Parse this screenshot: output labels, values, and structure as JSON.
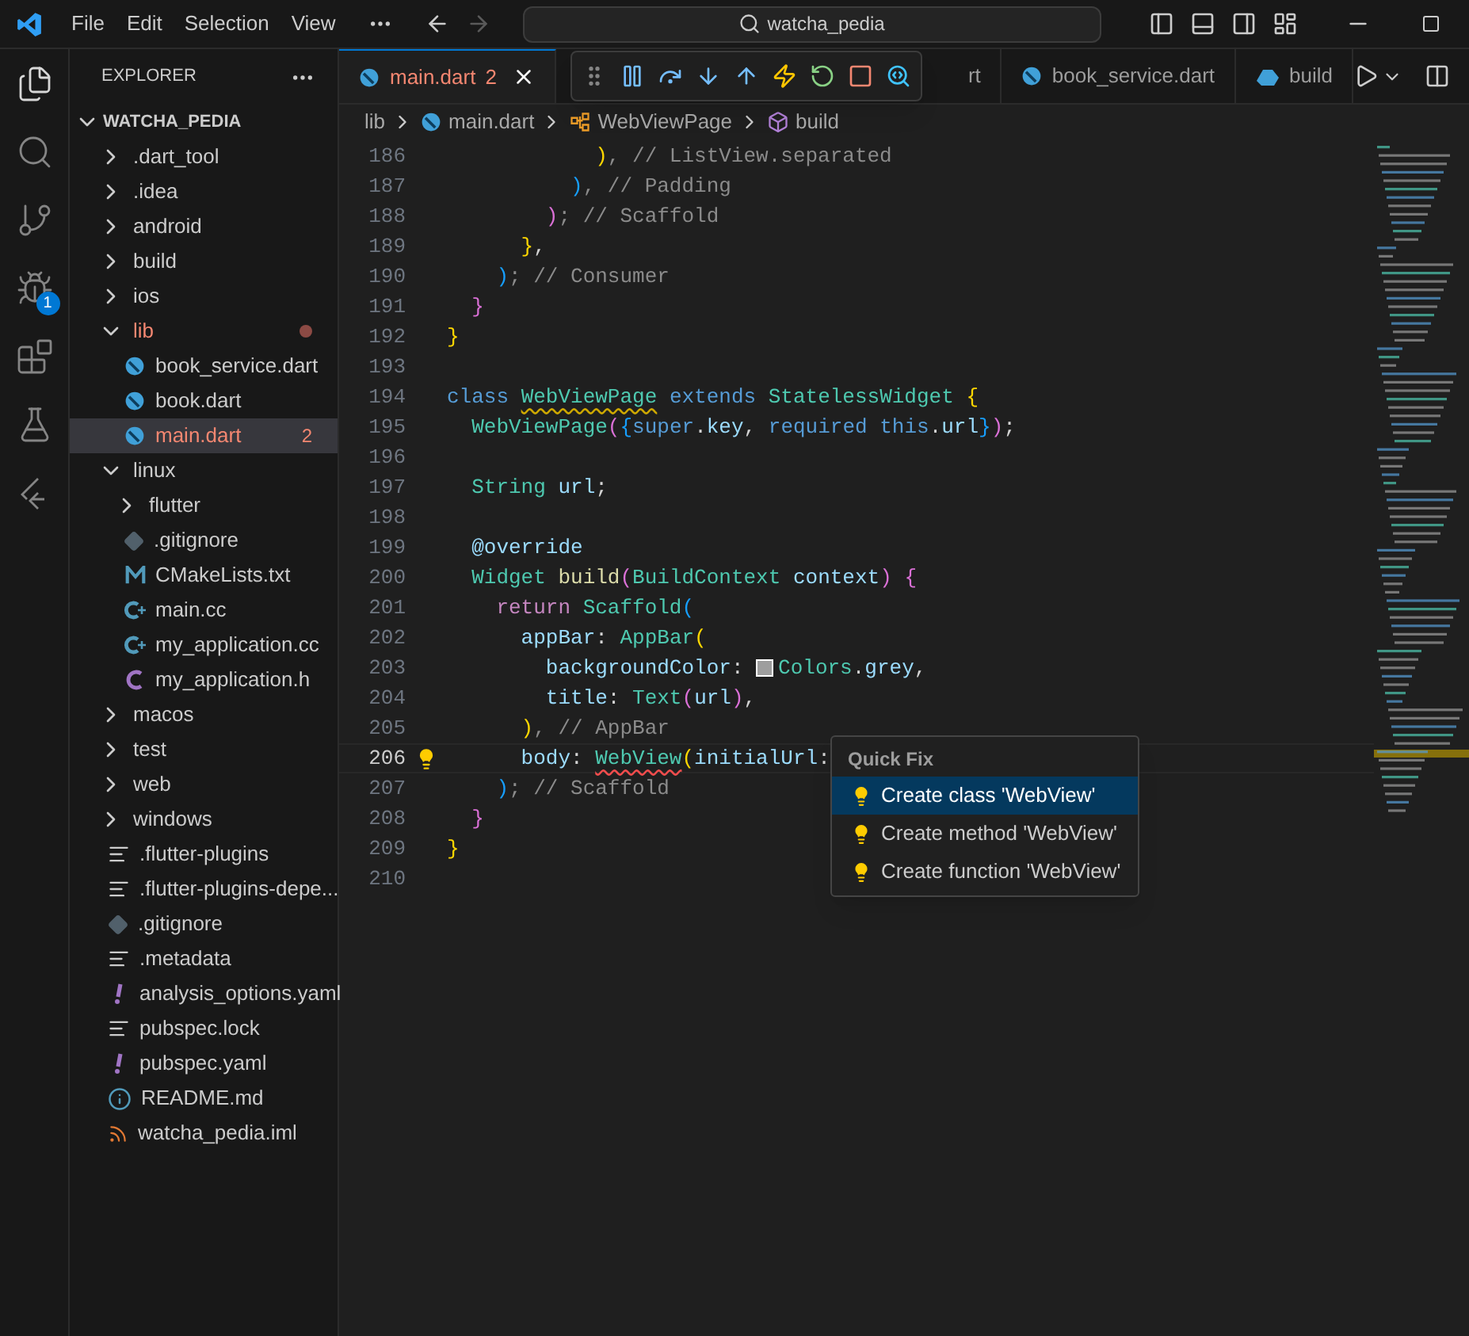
{
  "title_bar": {
    "menus": [
      "File",
      "Edit",
      "Selection",
      "View"
    ],
    "search": "watcha_pedia"
  },
  "activity_bar": [
    {
      "kind": "files",
      "selected": true
    },
    {
      "kind": "search",
      "selected": false
    },
    {
      "kind": "git",
      "selected": false
    },
    {
      "kind": "debug",
      "selected": false,
      "badge": "1"
    },
    {
      "kind": "extensions",
      "selected": false
    },
    {
      "kind": "testing",
      "selected": false
    },
    {
      "kind": "flutter",
      "selected": false
    }
  ],
  "explorer": {
    "title": "EXPLORER",
    "project": "WATCHA_PEDIA",
    "items": [
      {
        "kind": "folder",
        "name": ".dart_tool",
        "expanded": false
      },
      {
        "kind": "folder",
        "name": ".idea",
        "expanded": false
      },
      {
        "kind": "folder",
        "name": "android",
        "expanded": false
      },
      {
        "kind": "folder",
        "name": "build",
        "expanded": false
      },
      {
        "kind": "folder",
        "name": "ios",
        "expanded": false
      },
      {
        "kind": "folder",
        "name": "lib",
        "expanded": true,
        "error": true,
        "dot": true,
        "children": [
          {
            "kind": "dart",
            "name": "book_service.dart",
            "selected": false
          },
          {
            "kind": "dart",
            "name": "book.dart",
            "selected": false
          },
          {
            "kind": "dart",
            "name": "main.dart",
            "selected": true,
            "error": true,
            "badge": "2"
          }
        ]
      },
      {
        "kind": "folder",
        "name": "linux",
        "expanded": true,
        "children": [
          {
            "kind": "folder",
            "name": "flutter",
            "expanded": false
          },
          {
            "kind": "git",
            "name": ".gitignore"
          },
          {
            "kind": "cmake",
            "name": "CMakeLists.txt"
          },
          {
            "kind": "cpp",
            "name": "main.cc"
          },
          {
            "kind": "cpp",
            "name": "my_application.cc"
          },
          {
            "kind": "c",
            "name": "my_application.h"
          }
        ]
      },
      {
        "kind": "folder",
        "name": "macos",
        "expanded": false
      },
      {
        "kind": "folder",
        "name": "test",
        "expanded": false
      },
      {
        "kind": "folder",
        "name": "web",
        "expanded": false
      },
      {
        "kind": "folder",
        "name": "windows",
        "expanded": false
      },
      {
        "kind": "lines",
        "name": ".flutter-plugins"
      },
      {
        "kind": "lines",
        "name": ".flutter-plugins-depe..."
      },
      {
        "kind": "git",
        "name": ".gitignore"
      },
      {
        "kind": "lines",
        "name": ".metadata"
      },
      {
        "kind": "yaml",
        "name": "analysis_options.yaml"
      },
      {
        "kind": "lines",
        "name": "pubspec.lock"
      },
      {
        "kind": "yaml",
        "name": "pubspec.yaml"
      },
      {
        "kind": "info",
        "name": "README.md"
      },
      {
        "kind": "rss",
        "name": "watcha_pedia.iml"
      }
    ]
  },
  "tabs": [
    {
      "kind": "dart",
      "label": "main.dart",
      "badge": "2",
      "selected": true,
      "error": true
    },
    {
      "label": "rt",
      "selected": false
    },
    {
      "kind": "dart",
      "label": "book_service.dart",
      "selected": false
    },
    {
      "kind": "devtools",
      "label": "build",
      "selected": false
    }
  ],
  "breadcrumbs": [
    {
      "kind": "folder",
      "label": "lib"
    },
    {
      "kind": "dart",
      "label": "main.dart"
    },
    {
      "kind": "class",
      "label": "WebViewPage"
    },
    {
      "kind": "method",
      "label": "build"
    }
  ],
  "debug_toolbar": [
    {
      "kind": "grip"
    },
    {
      "kind": "pause"
    },
    {
      "kind": "step-over"
    },
    {
      "kind": "step-into"
    },
    {
      "kind": "step-out"
    },
    {
      "kind": "hot-reload"
    },
    {
      "kind": "restart"
    },
    {
      "kind": "stop"
    },
    {
      "kind": "devtools"
    }
  ],
  "code": [
    {
      "number": "186",
      "tokens": [
        {
          "text": "            )",
          "kind": "b1"
        },
        {
          "text": ", // ListView.separated",
          "kind": "cmt"
        }
      ]
    },
    {
      "number": "187",
      "tokens": [
        {
          "text": "          )",
          "kind": "b3"
        },
        {
          "text": ", // Padding",
          "kind": "cmt"
        }
      ]
    },
    {
      "number": "188",
      "tokens": [
        {
          "text": "        )",
          "kind": "b2"
        },
        {
          "text": "; // Scaffold",
          "kind": "cmt"
        }
      ]
    },
    {
      "number": "189",
      "tokens": [
        {
          "text": "      }",
          "kind": "b1"
        },
        {
          "text": ",",
          "kind": "p"
        }
      ]
    },
    {
      "number": "190",
      "tokens": [
        {
          "text": "    )",
          "kind": "b3"
        },
        {
          "text": "; // Consumer",
          "kind": "cmt"
        }
      ]
    },
    {
      "number": "191",
      "tokens": [
        {
          "text": "  }",
          "kind": "b2"
        }
      ]
    },
    {
      "number": "192",
      "tokens": [
        {
          "text": "}",
          "kind": "b1"
        }
      ]
    },
    {
      "number": "193"
    },
    {
      "number": "194",
      "tokens": [
        {
          "text": "class ",
          "kind": "kw"
        },
        {
          "text": "WebViewPage",
          "kind": "type",
          "warning": true
        },
        {
          "text": " extends ",
          "kind": "kw"
        },
        {
          "text": "StatelessWidget ",
          "kind": "type"
        },
        {
          "text": "{",
          "kind": "b1"
        }
      ]
    },
    {
      "number": "195",
      "tokens": [
        {
          "text": "  WebViewPage",
          "kind": "type"
        },
        {
          "text": "(",
          "kind": "b2"
        },
        {
          "text": "{",
          "kind": "b3"
        },
        {
          "text": "super",
          "kind": "kw"
        },
        {
          "text": ".",
          "kind": "p"
        },
        {
          "text": "key",
          "kind": "var"
        },
        {
          "text": ", ",
          "kind": "p"
        },
        {
          "text": "required this",
          "kind": "kw"
        },
        {
          "text": ".",
          "kind": "p"
        },
        {
          "text": "url",
          "kind": "var"
        },
        {
          "text": "}",
          "kind": "b3"
        },
        {
          "text": ")",
          "kind": "b2"
        },
        {
          "text": ";",
          "kind": "p"
        }
      ]
    },
    {
      "number": "196"
    },
    {
      "number": "197",
      "tokens": [
        {
          "text": "  String ",
          "kind": "type"
        },
        {
          "text": "url",
          "kind": "var"
        },
        {
          "text": ";",
          "kind": "p"
        }
      ]
    },
    {
      "number": "198"
    },
    {
      "number": "199",
      "tokens": [
        {
          "text": "  @override",
          "kind": "var"
        }
      ]
    },
    {
      "number": "200",
      "tokens": [
        {
          "text": "  Widget ",
          "kind": "type"
        },
        {
          "text": "build",
          "kind": "fn"
        },
        {
          "text": "(",
          "kind": "b2"
        },
        {
          "text": "BuildContext ",
          "kind": "type"
        },
        {
          "text": "context",
          "kind": "var"
        },
        {
          "text": ") ",
          "kind": "b2"
        },
        {
          "text": "{",
          "kind": "b2"
        }
      ]
    },
    {
      "number": "201",
      "tokens": [
        {
          "text": "    return ",
          "kind": "ctl"
        },
        {
          "text": "Scaffold",
          "kind": "type"
        },
        {
          "text": "(",
          "kind": "b3"
        }
      ]
    },
    {
      "number": "202",
      "tokens": [
        {
          "text": "      appBar",
          "kind": "var"
        },
        {
          "text": ": ",
          "kind": "p"
        },
        {
          "text": "AppBar",
          "kind": "type"
        },
        {
          "text": "(",
          "kind": "b1"
        }
      ]
    },
    {
      "number": "203",
      "tokens": [
        {
          "text": "        backgroundColor",
          "kind": "var"
        },
        {
          "text": ": ",
          "kind": "p"
        },
        {
          "kind": "swatch"
        },
        {
          "text": "Colors",
          "kind": "type"
        },
        {
          "text": ".",
          "kind": "p"
        },
        {
          "text": "grey",
          "kind": "var"
        },
        {
          "text": ",",
          "kind": "p"
        }
      ]
    },
    {
      "number": "204",
      "tokens": [
        {
          "text": "        title",
          "kind": "var"
        },
        {
          "text": ": ",
          "kind": "p"
        },
        {
          "text": "Text",
          "kind": "type"
        },
        {
          "text": "(",
          "kind": "b2"
        },
        {
          "text": "url",
          "kind": "var"
        },
        {
          "text": ")",
          "kind": "b2"
        },
        {
          "text": ",",
          "kind": "p"
        }
      ]
    },
    {
      "number": "205",
      "tokens": [
        {
          "text": "      )",
          "kind": "b1"
        },
        {
          "text": ", // AppBar",
          "kind": "cmt"
        }
      ]
    },
    {
      "number": "206",
      "current": true,
      "lightbulb": true,
      "tokens": [
        {
          "text": "      body",
          "kind": "var"
        },
        {
          "text": ": ",
          "kind": "p"
        },
        {
          "text": "WebView",
          "kind": "type",
          "error": true
        },
        {
          "text": "(",
          "kind": "b1"
        },
        {
          "text": "initialUrl",
          "kind": "var"
        },
        {
          "text": ":",
          "kind": "p"
        }
      ]
    },
    {
      "number": "207",
      "tokens": [
        {
          "text": "    )",
          "kind": "b3"
        },
        {
          "text": "; // Scaffold",
          "kind": "cmt"
        }
      ]
    },
    {
      "number": "208",
      "tokens": [
        {
          "text": "  }",
          "kind": "b2"
        }
      ]
    },
    {
      "number": "209",
      "tokens": [
        {
          "text": "}",
          "kind": "b1"
        }
      ]
    },
    {
      "number": "210"
    }
  ],
  "quick_fix": {
    "title": "Quick Fix",
    "items": [
      {
        "label": "Create class 'WebView'",
        "selected": true
      },
      {
        "label": "Create method 'WebView'",
        "selected": false
      },
      {
        "label": "Create function 'WebView'",
        "selected": false
      }
    ]
  }
}
